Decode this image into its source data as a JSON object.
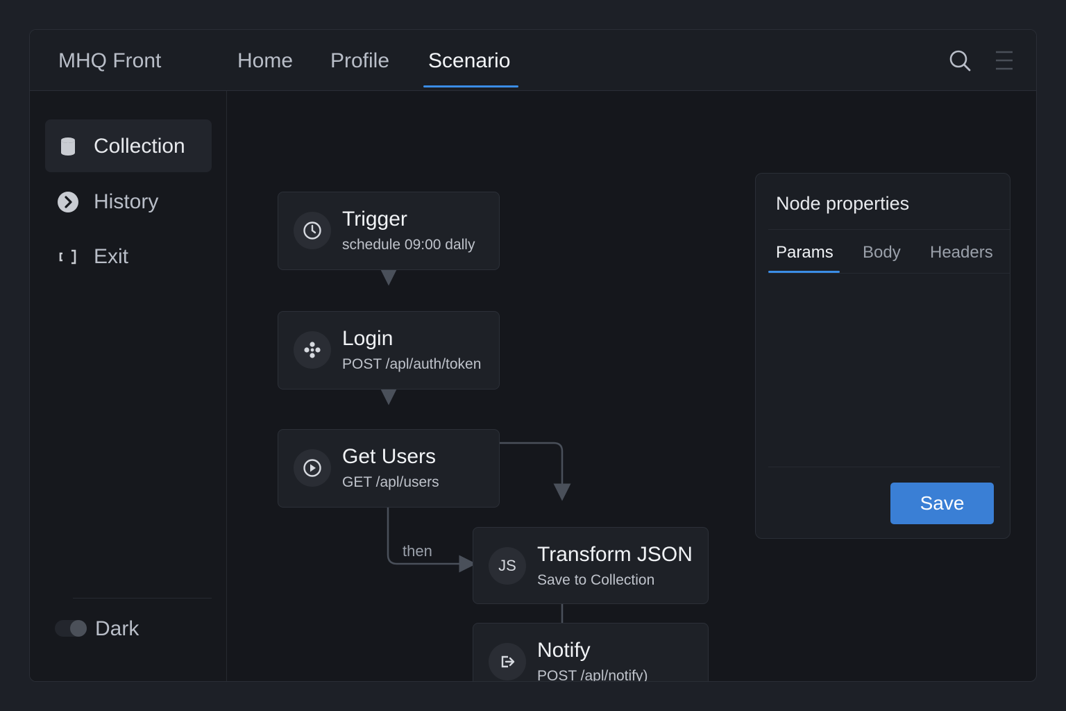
{
  "app": {
    "title": "MHQ Front"
  },
  "nav": {
    "tabs": [
      {
        "label": "Home",
        "active": false
      },
      {
        "label": "Profile",
        "active": false
      },
      {
        "label": "Scenario",
        "active": true
      }
    ],
    "icons": [
      "search-icon",
      "menu-icon"
    ]
  },
  "sidebar": {
    "items": [
      {
        "label": "Collection",
        "icon": "database-icon",
        "active": true
      },
      {
        "label": "History",
        "icon": "chevron-right-circle-icon",
        "active": false
      },
      {
        "label": "Exit",
        "icon": "exit-icon",
        "active": false
      }
    ],
    "theme_toggle": {
      "label": "Dark"
    }
  },
  "flow": {
    "nodes": [
      {
        "title": "Trigger",
        "subtitle": "schedule 09:00 dally",
        "icon": "clock-icon"
      },
      {
        "title": "Login",
        "subtitle": "POST /apl/auth/token",
        "icon": "nodes-icon"
      },
      {
        "title": "Get Users",
        "subtitle": "GET /apl/users",
        "icon": "play-circle-icon"
      },
      {
        "title": "Transform JSON",
        "subtitle": "Save to Collection",
        "icon": "js-icon",
        "badge_text": "JS"
      },
      {
        "title": "Notify",
        "subtitle": "POST /apl/notify)",
        "icon": "forward-icon"
      }
    ],
    "edge_label": "then"
  },
  "panel": {
    "title": "Node properties",
    "tabs": [
      {
        "label": "Params",
        "active": true
      },
      {
        "label": "Body",
        "active": false
      },
      {
        "label": "Headers",
        "active": false
      }
    ],
    "save_label": "Save"
  },
  "colors": {
    "accent": "#3b8de6",
    "button": "#3a7fd5",
    "background": "#1d2027"
  }
}
